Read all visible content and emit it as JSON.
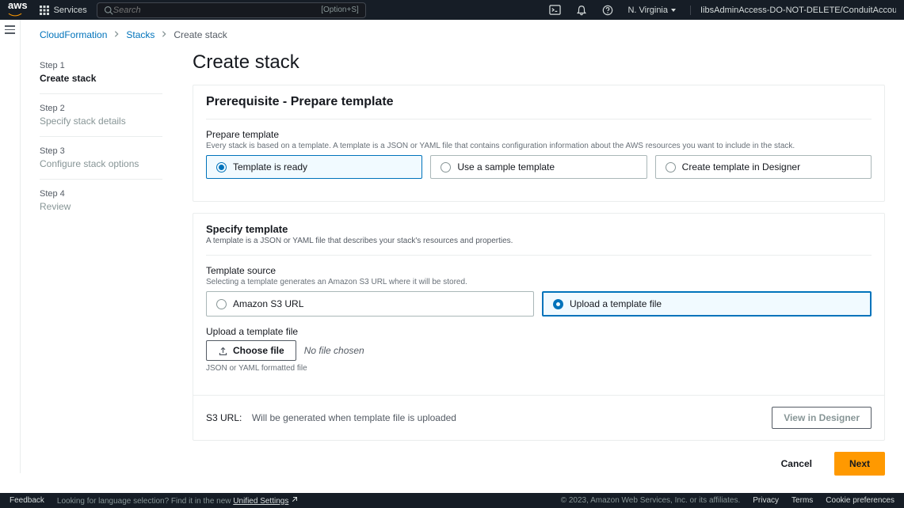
{
  "header": {
    "services_label": "Services",
    "search_placeholder": "Search",
    "search_shortcut": "[Option+S]",
    "region": "N. Virginia",
    "account": "IibsAdminAccess-DO-NOT-DELETE/ConduitAccountService+Prod+Defa..."
  },
  "breadcrumb": {
    "root": "CloudFormation",
    "stacks": "Stacks",
    "current": "Create stack"
  },
  "steps": [
    {
      "label": "Step 1",
      "title": "Create stack",
      "active": true
    },
    {
      "label": "Step 2",
      "title": "Specify stack details",
      "active": false
    },
    {
      "label": "Step 3",
      "title": "Configure stack options",
      "active": false
    },
    {
      "label": "Step 4",
      "title": "Review",
      "active": false
    }
  ],
  "page_title": "Create stack",
  "prereq": {
    "title": "Prerequisite - Prepare template",
    "field_label": "Prepare template",
    "field_hint": "Every stack is based on a template. A template is a JSON or YAML file that contains configuration information about the AWS resources you want to include in the stack.",
    "options": {
      "ready": "Template is ready",
      "sample": "Use a sample template",
      "designer": "Create template in Designer"
    }
  },
  "specify": {
    "title": "Specify template",
    "desc": "A template is a JSON or YAML file that describes your stack's resources and properties.",
    "source_label": "Template source",
    "source_hint": "Selecting a template generates an Amazon S3 URL where it will be stored.",
    "options": {
      "s3": "Amazon S3 URL",
      "upload": "Upload a template file"
    },
    "upload_label": "Upload a template file",
    "choose_file": "Choose file",
    "no_file": "No file chosen",
    "file_hint": "JSON or YAML formatted file",
    "s3url_label": "S3 URL:",
    "s3url_value": "Will be generated when template file is uploaded",
    "view_designer": "View in Designer"
  },
  "actions": {
    "cancel": "Cancel",
    "next": "Next"
  },
  "footer": {
    "feedback": "Feedback",
    "lang_text_pre": "Looking for language selection? Find it in the new ",
    "lang_link": "Unified Settings",
    "copyright": "© 2023, Amazon Web Services, Inc. or its affiliates.",
    "privacy": "Privacy",
    "terms": "Terms",
    "cookies": "Cookie preferences"
  }
}
